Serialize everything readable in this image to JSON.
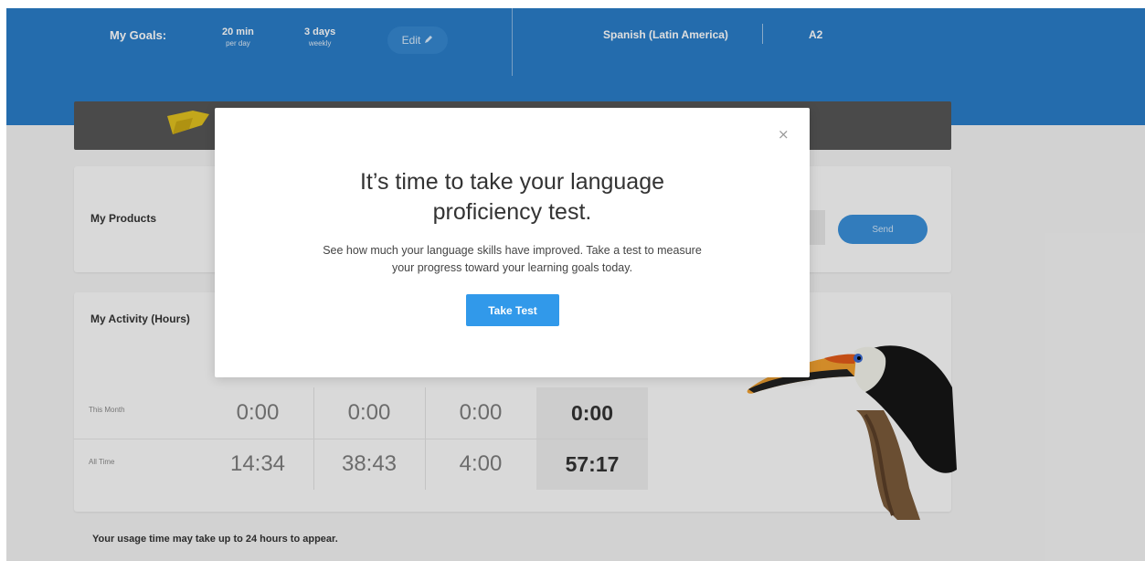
{
  "header": {
    "goals_label": "My Goals:",
    "goal_minutes": {
      "value": "20 min",
      "unit": "per day"
    },
    "goal_days": {
      "value": "3 days",
      "unit": "weekly"
    },
    "edit_label": "Edit",
    "language": "Spanish (Latin America)",
    "level": "A2"
  },
  "products": {
    "title": "My Products",
    "send_label": "Send"
  },
  "activity": {
    "title": "My Activity (Hours)",
    "rows": [
      {
        "label": "This Month",
        "values": [
          "0:00",
          "0:00",
          "0:00"
        ],
        "total": "0:00"
      },
      {
        "label": "All Time",
        "values": [
          "14:34",
          "38:43",
          "4:00"
        ],
        "total": "57:17"
      }
    ]
  },
  "usage_note": "Your usage time may take up to 24 hours to appear.",
  "modal": {
    "close_symbol": "×",
    "title_line1": "It’s time to take your language",
    "title_line2": "proficiency test.",
    "body_line1": "See how much your language skills have improved. Take a test to measure",
    "body_line2": "your progress toward your learning goals today.",
    "cta_label": "Take Test"
  },
  "icons": {
    "edit": "pencil-icon",
    "close": "close-icon",
    "flag": "flag-illustration",
    "toucan": "toucan-illustration"
  },
  "colors": {
    "header": "#2a7cc7",
    "accent": "#3199ea",
    "banner": "#555555"
  }
}
